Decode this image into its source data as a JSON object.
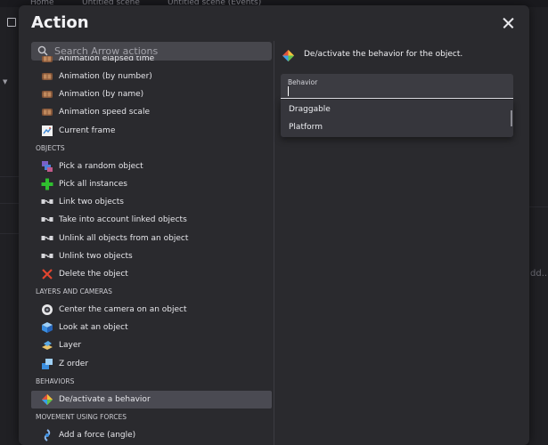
{
  "background": {
    "tabs": [
      {
        "label": "Home"
      },
      {
        "label": "Untitled scene"
      },
      {
        "label": "Untitled scene (Events)"
      }
    ],
    "right_fragment": "dd..."
  },
  "dialog": {
    "title": "Action",
    "search": {
      "placeholder": "Search Arrow actions",
      "value": ""
    },
    "items": [
      {
        "type": "item",
        "label": "Animation elapsed time",
        "icon": "film-strip-icon"
      },
      {
        "type": "item",
        "label": "Animation (by number)",
        "icon": "film-strip-icon"
      },
      {
        "type": "item",
        "label": "Animation (by name)",
        "icon": "film-strip-icon"
      },
      {
        "type": "item",
        "label": "Animation speed scale",
        "icon": "film-strip-icon"
      },
      {
        "type": "item",
        "label": "Current frame",
        "icon": "frame-icon"
      },
      {
        "type": "group",
        "label": "OBJECTS"
      },
      {
        "type": "item",
        "label": "Pick a random object",
        "icon": "random-objects-icon"
      },
      {
        "type": "item",
        "label": "Pick all instances",
        "icon": "plus-icon"
      },
      {
        "type": "item",
        "label": "Link two objects",
        "icon": "link-icon"
      },
      {
        "type": "item",
        "label": "Take into account linked objects",
        "icon": "link-icon"
      },
      {
        "type": "item",
        "label": "Unlink all objects from an object",
        "icon": "link-icon"
      },
      {
        "type": "item",
        "label": "Unlink two objects",
        "icon": "link-icon"
      },
      {
        "type": "item",
        "label": "Delete the object",
        "icon": "delete-x-icon"
      },
      {
        "type": "group",
        "label": "LAYERS AND CAMERAS"
      },
      {
        "type": "item",
        "label": "Center the camera on an object",
        "icon": "camera-icon"
      },
      {
        "type": "item",
        "label": "Look at an object",
        "icon": "cube-icon"
      },
      {
        "type": "item",
        "label": "Layer",
        "icon": "layer-icon"
      },
      {
        "type": "item",
        "label": "Z order",
        "icon": "z-order-icon"
      },
      {
        "type": "group",
        "label": "BEHAVIORS"
      },
      {
        "type": "item",
        "label": "De/activate a behavior",
        "icon": "behavior-icon",
        "selected": true
      },
      {
        "type": "group",
        "label": "MOVEMENT USING FORCES"
      },
      {
        "type": "item",
        "label": "Add a force (angle)",
        "icon": "force-icon"
      }
    ],
    "description": "De/activate the behavior for the object.",
    "behavior_field": {
      "label": "Behavior",
      "value": "",
      "options": [
        "Draggable",
        "Platform"
      ]
    },
    "colors": {
      "dialog_bg": "#2a2a2e",
      "selected_row": "#4a4a52",
      "search_bg": "#47474d"
    }
  }
}
